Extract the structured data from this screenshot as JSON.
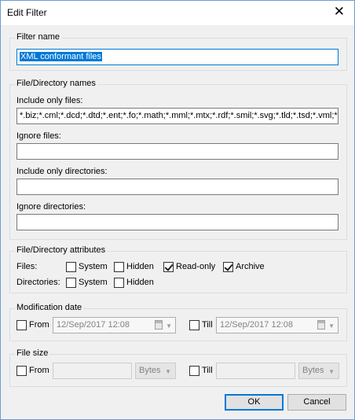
{
  "window": {
    "title": "Edit Filter",
    "close_glyph": "✕"
  },
  "filter_name": {
    "legend": "Filter name",
    "value": "XML conformant files"
  },
  "names": {
    "legend": "File/Directory names",
    "include_files_label": "Include only files:",
    "include_files_value": "*.biz;*.cml;*.dcd;*.dtd;*.ent;*.fo;*.math;*.mml;*.mtx;*.rdf;*.smil;*.svg;*.tld;*.tsd;*.vml;*.vxml",
    "ignore_files_label": "Ignore files:",
    "ignore_files_value": "",
    "include_dirs_label": "Include only directories:",
    "include_dirs_value": "",
    "ignore_dirs_label": "Ignore directories:",
    "ignore_dirs_value": ""
  },
  "attributes": {
    "legend": "File/Directory attributes",
    "files_label": "Files:",
    "dirs_label": "Directories:",
    "files": [
      {
        "label": "System",
        "checked": false
      },
      {
        "label": "Hidden",
        "checked": false
      },
      {
        "label": "Read-only",
        "checked": true
      },
      {
        "label": "Archive",
        "checked": true
      }
    ],
    "dirs": [
      {
        "label": "System",
        "checked": false
      },
      {
        "label": "Hidden",
        "checked": false
      }
    ]
  },
  "modification_date": {
    "legend": "Modification date",
    "from_label": "From",
    "from_value": "12/Sep/2017 12:08",
    "till_label": "Till",
    "till_value": "12/Sep/2017 12:08",
    "dropdown_glyph": "▼"
  },
  "file_size": {
    "legend": "File size",
    "from_label": "From",
    "till_label": "Till",
    "unit_from": "Bytes",
    "unit_till": "Bytes",
    "dropdown_glyph": "▼"
  },
  "buttons": {
    "ok": "OK",
    "cancel": "Cancel"
  }
}
